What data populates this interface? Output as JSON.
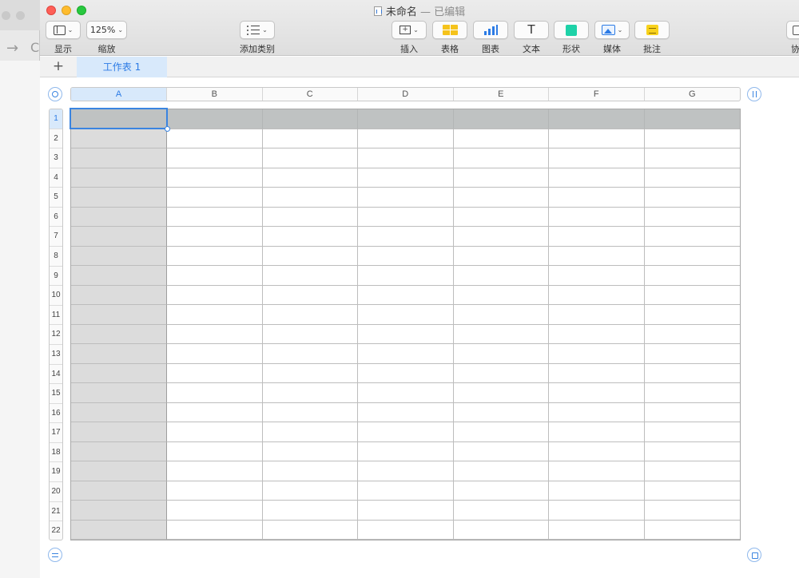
{
  "window": {
    "title": "未命名",
    "status": "— 已编辑"
  },
  "toolbar": {
    "view_label": "显示",
    "zoom_value": "125%",
    "zoom_label": "缩放",
    "category_label": "添加类别",
    "insert_label": "插入",
    "table_label": "表格",
    "chart_label": "图表",
    "text_label": "文本",
    "shape_label": "形状",
    "media_label": "媒体",
    "comment_label": "批注",
    "share_label_partial": "协"
  },
  "sheets": {
    "add_symbol": "+",
    "tabs": [
      {
        "label": "工作表 1",
        "active": true
      }
    ]
  },
  "table": {
    "columns": [
      "A",
      "B",
      "C",
      "D",
      "E",
      "F",
      "G"
    ],
    "rows": [
      "1",
      "2",
      "3",
      "4",
      "5",
      "6",
      "7",
      "8",
      "9",
      "10",
      "11",
      "12",
      "13",
      "14",
      "15",
      "16",
      "17",
      "18",
      "19",
      "20",
      "21",
      "22"
    ],
    "selected_cell": "A1",
    "header_row_color": "#bfc2c2",
    "header_col_color": "#dcdcdc"
  },
  "colors": {
    "accent": "#2c7be5",
    "selection": "#3a84e0",
    "table_icon": "#f5c31c",
    "shape_icon": "#1ed2a8",
    "comment_icon": "#f8d21c"
  },
  "icons": {
    "view": "sidebar-view-icon",
    "category": "list-icon",
    "insert": "insert-icon",
    "table": "table-icon",
    "chart": "bar-chart-icon",
    "text": "text-icon",
    "shape": "shape-icon",
    "media": "image-icon",
    "comment": "comment-icon"
  }
}
